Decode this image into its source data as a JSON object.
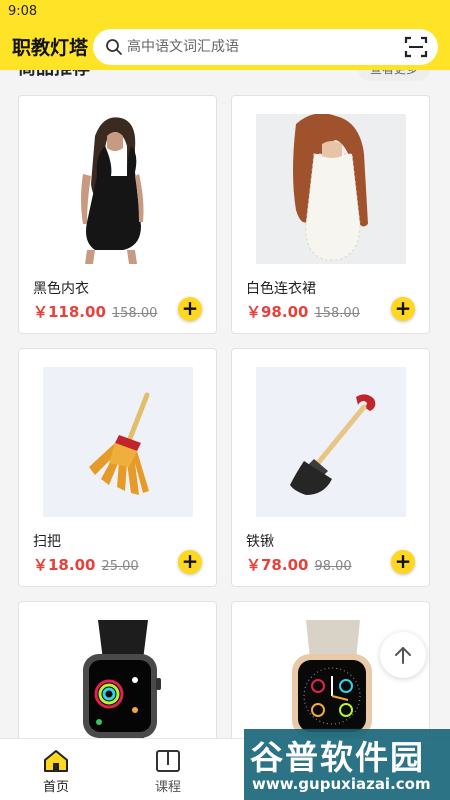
{
  "status_bar": {
    "time": "9:08"
  },
  "header": {
    "title": "职教灯塔",
    "search_placeholder": "高中语文词汇成语",
    "search_icon": "search-icon",
    "scan_icon": "scan-icon"
  },
  "section": {
    "title": "商品推荐",
    "more_label": "查看更多"
  },
  "products": [
    {
      "name": "黑色内衣",
      "price": "￥118.00",
      "old_price": "158.00",
      "image": "black-dress"
    },
    {
      "name": "白色连衣裙",
      "price": "￥98.00",
      "old_price": "158.00",
      "image": "white-dress"
    },
    {
      "name": "扫把",
      "price": "￥18.00",
      "old_price": "25.00",
      "image": "broom"
    },
    {
      "name": "铁锹",
      "price": "￥78.00",
      "old_price": "98.00",
      "image": "shovel"
    },
    {
      "name": "",
      "price": "",
      "old_price": "",
      "image": "black-watch"
    },
    {
      "name": "",
      "price": "",
      "old_price": "",
      "image": "gold-watch"
    }
  ],
  "add_label": "+",
  "tabs": [
    {
      "label": "首页",
      "icon": "home-icon",
      "active": true
    },
    {
      "label": "课程",
      "icon": "book-icon",
      "active": false
    }
  ],
  "back_to_top_icon": "arrow-up-icon",
  "watermark": {
    "main": "谷普软件园",
    "url": "www.gupuxiazai.com"
  },
  "colors": {
    "accent": "#ffe326",
    "price": "#e8413b",
    "add_button": "#ffd71f"
  }
}
